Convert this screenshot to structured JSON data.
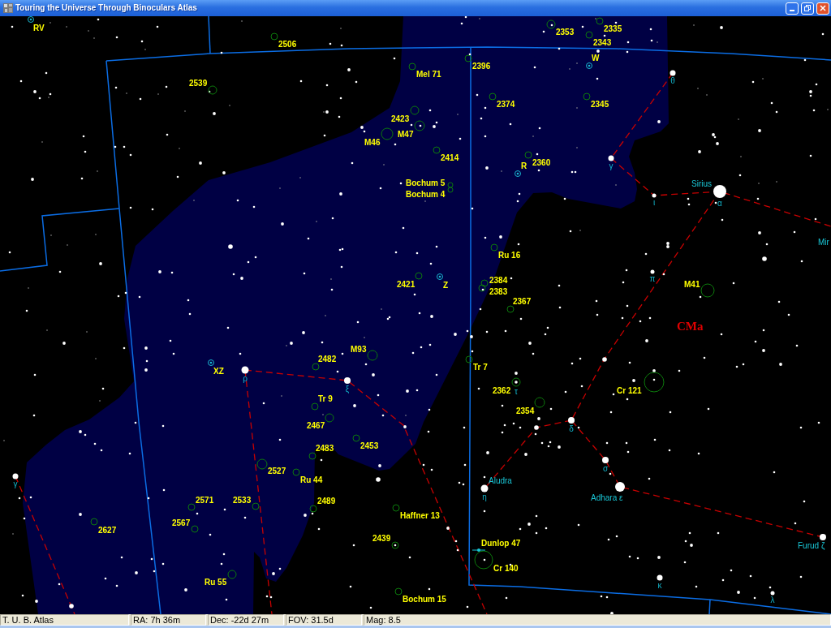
{
  "window": {
    "title": "Touring the Universe Through Binoculars Atlas"
  },
  "map": {
    "constellation_label": "CMa",
    "deep_sky_objects": [
      "2506",
      "2353",
      "2335",
      "2343",
      "2396",
      "Mel 71",
      "2539",
      "2374",
      "2345",
      "2423",
      "M47",
      "M46",
      "2414",
      "2360",
      "Bochum 5",
      "Bochum 4",
      "Ru 16",
      "2421",
      "2384",
      "2383",
      "M41",
      "2367",
      "M93",
      "Tr 7",
      "2482",
      "2362",
      "Cr 121",
      "Tr 9",
      "2354",
      "2467",
      "2453",
      "2483",
      "2527",
      "Ru 44",
      "2571",
      "2533",
      "2489",
      "Haffner 13",
      "2627",
      "2567",
      "2439",
      "Cr 140",
      "Ru 55",
      "Bochum 15"
    ],
    "double_stars": [
      "Dunlop 47"
    ],
    "variable_stars": [
      "RV",
      "W",
      "R",
      "Z",
      "XZ"
    ],
    "star_names": [
      "Sirius",
      "Mir",
      "Aludra",
      "Adhara ε",
      "Furud ζ"
    ],
    "greek_letters": [
      "θ",
      "γ",
      "ι",
      "α",
      "π",
      "ρ",
      "ξ",
      "τ",
      "δ",
      "σ",
      "η",
      "κ",
      "λ",
      "γ"
    ]
  },
  "status_bar": [
    "T. U. B. Atlas",
    "RA: 7h 36m",
    "Dec: -22d 27m",
    "FOV: 31.5d",
    "Mag: 8.5"
  ]
}
